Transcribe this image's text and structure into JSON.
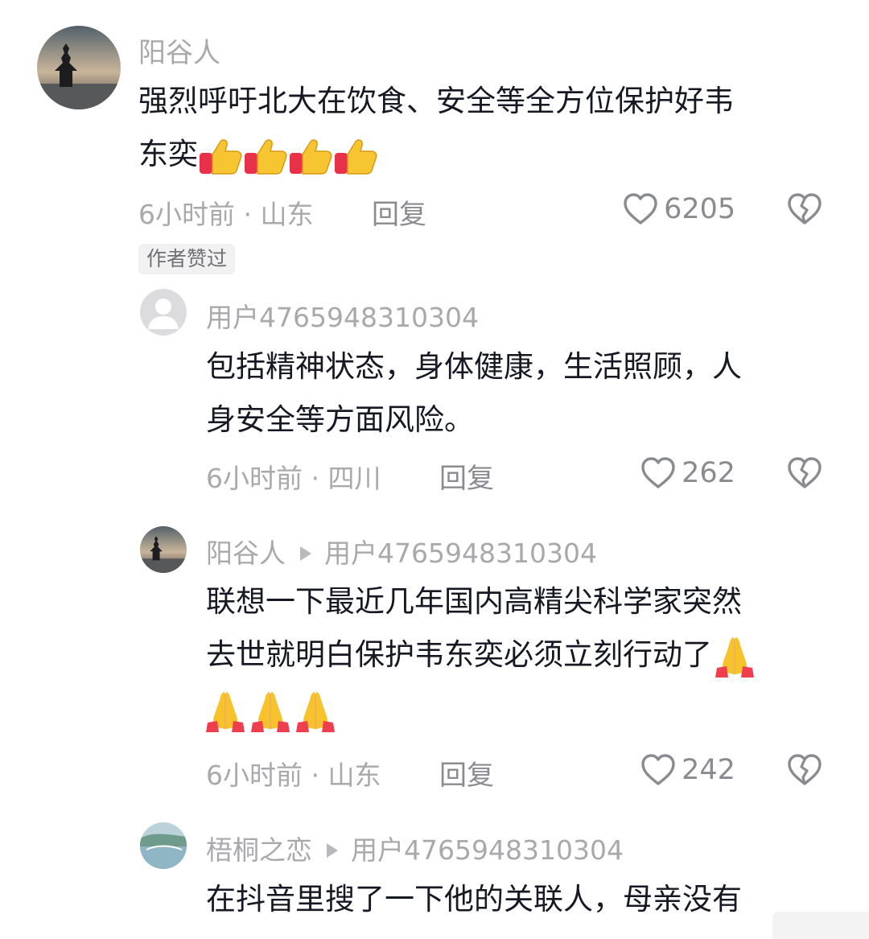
{
  "comments": [
    {
      "user": "阳谷人",
      "text_lines": [
        "强烈呼吁北大在饮食、安全等全方位保护好韦",
        "东奕"
      ],
      "emoji": [
        "thumbs-up",
        "thumbs-up",
        "thumbs-up",
        "thumbs-up"
      ],
      "time": "6小时前",
      "location": "山东",
      "reply_label": "回复",
      "likes": "6205",
      "tag": "作者赞过"
    }
  ],
  "replies": [
    {
      "user": "用户4765948310304",
      "text_lines": [
        "包括精神状态，身体健康，生活照顾，人",
        "身安全等方面风险。"
      ],
      "time": "6小时前",
      "location": "四川",
      "reply_label": "回复",
      "likes": "262"
    },
    {
      "user": "阳谷人",
      "reply_to": "用户4765948310304",
      "text_lines": [
        "联想一下最近几年国内高精尖科学家突然",
        "去世就明白保护韦东奕必须立刻行动了"
      ],
      "emoji": [
        "folded-hands",
        "folded-hands",
        "folded-hands",
        "folded-hands"
      ],
      "time": "6小时前",
      "location": "山东",
      "reply_label": "回复",
      "likes": "242"
    },
    {
      "user": "梧桐之恋",
      "reply_to": "用户4765948310304",
      "text_lines": [
        "在抖音里搜了一下他的关联人，母亲没有"
      ]
    }
  ],
  "separator": " · ",
  "colors": {
    "text": "#161823",
    "muted": "#a9a9ad",
    "reply_action": "#8a8b91",
    "tag_bg": "#f1f1f2"
  }
}
